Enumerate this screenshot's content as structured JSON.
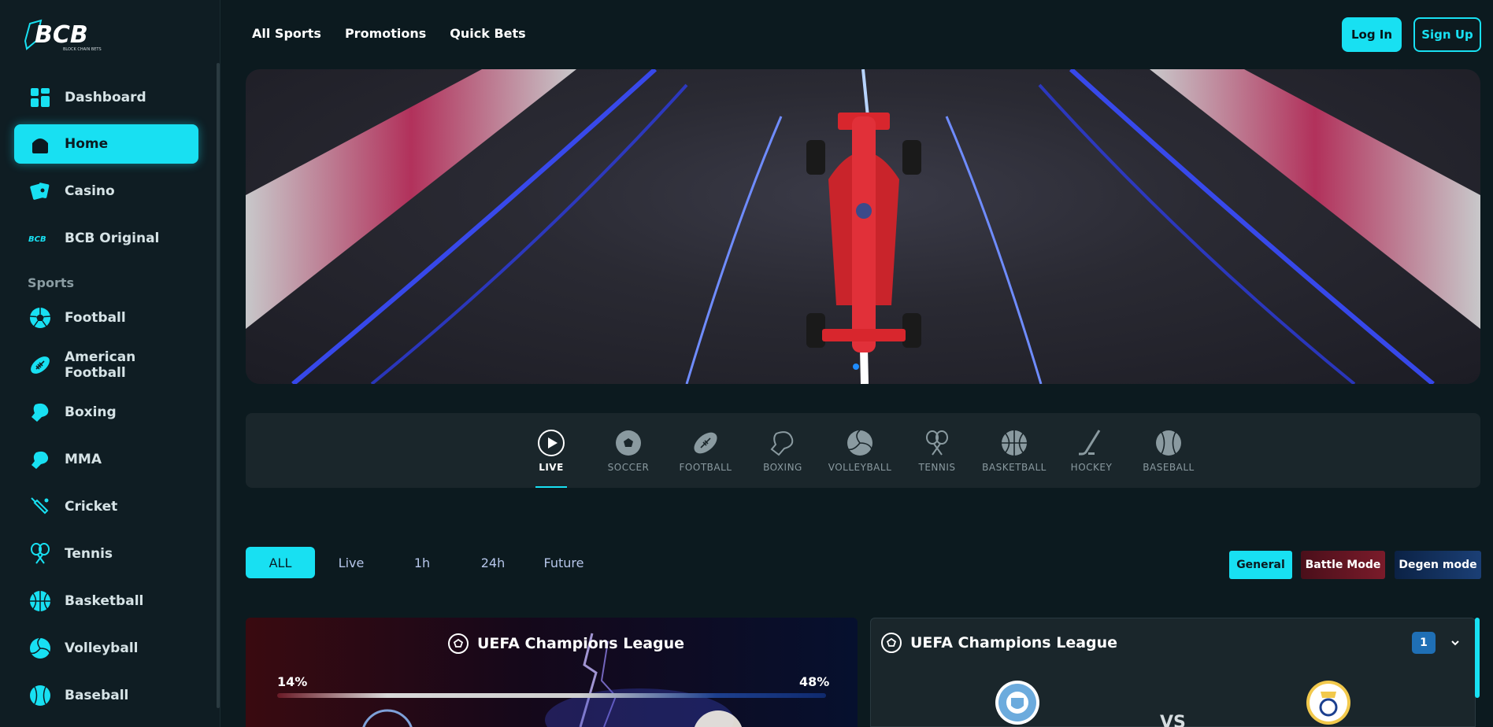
{
  "brand": {
    "logo_text": "BCB",
    "logo_sub": "BLOCK CHAIN BETS",
    "accent": "#18e0f2"
  },
  "sidebar": {
    "main_items": [
      {
        "label": "Dashboard",
        "icon": "dashboard-icon"
      },
      {
        "label": "Home",
        "icon": "home-icon",
        "active": true
      },
      {
        "label": "Casino",
        "icon": "cards-icon"
      },
      {
        "label": "BCB Original",
        "icon": "bcb-logo-icon"
      }
    ],
    "section_label": "Sports",
    "sport_items": [
      {
        "label": "Football",
        "icon": "soccer-ball-icon"
      },
      {
        "label": "American Football",
        "icon": "american-football-icon"
      },
      {
        "label": "Boxing",
        "icon": "boxing-glove-icon"
      },
      {
        "label": "MMA",
        "icon": "mma-glove-icon"
      },
      {
        "label": "Cricket",
        "icon": "cricket-bat-icon"
      },
      {
        "label": "Tennis",
        "icon": "tennis-rackets-icon"
      },
      {
        "label": "Basketball",
        "icon": "basketball-icon"
      },
      {
        "label": "Volleyball",
        "icon": "volleyball-icon"
      },
      {
        "label": "Baseball",
        "icon": "baseball-icon"
      }
    ]
  },
  "topnav": {
    "links": [
      "All Sports",
      "Promotions",
      "Quick Bets"
    ],
    "login_label": "Log In",
    "signup_label": "Sign Up"
  },
  "sport_tabs": [
    {
      "label": "LIVE",
      "icon": "play-circle-icon",
      "active": true
    },
    {
      "label": "SOCCER",
      "icon": "soccer-ball-icon"
    },
    {
      "label": "FOOTBALL",
      "icon": "american-football-icon"
    },
    {
      "label": "BOXING",
      "icon": "boxing-glove-icon"
    },
    {
      "label": "VOLLEYBALL",
      "icon": "volleyball-icon"
    },
    {
      "label": "TENNIS",
      "icon": "tennis-rackets-icon"
    },
    {
      "label": "BASKETBALL",
      "icon": "basketball-icon"
    },
    {
      "label": "HOCKEY",
      "icon": "hockey-stick-icon"
    },
    {
      "label": "BASEBALL",
      "icon": "baseball-icon"
    }
  ],
  "time_filters": [
    "ALL",
    "Live",
    "1h",
    "24h",
    "Future"
  ],
  "modes": [
    {
      "label": "General",
      "color": "#18e0f2"
    },
    {
      "label": "Battle Mode",
      "color": "#6b1825"
    },
    {
      "label": "Degen mode",
      "color": "#12305a"
    }
  ],
  "cards": {
    "left": {
      "league": "UEFA Champions League",
      "home_pct": "14%",
      "away_pct": "48%"
    },
    "right": {
      "league": "UEFA Champions League",
      "count": "1",
      "vs": "VS"
    }
  }
}
